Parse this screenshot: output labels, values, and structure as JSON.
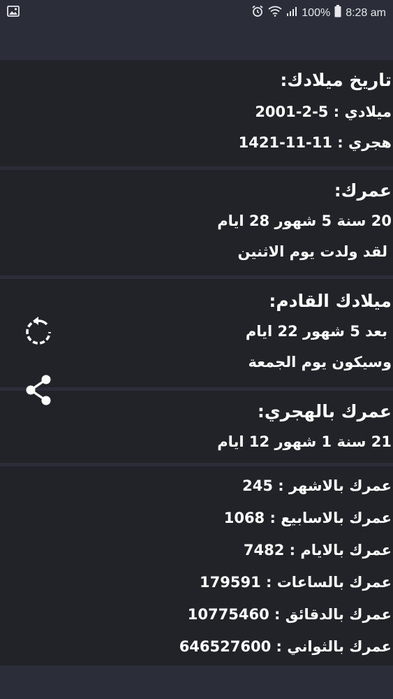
{
  "status_bar": {
    "battery": "100%",
    "time": "8:28 am",
    "left_icon": "image-icon",
    "right_icons": [
      "alarm-icon",
      "wifi-icon",
      "signal-icon",
      "battery-icon"
    ]
  },
  "birth_date": {
    "title": "تاريخ ميلادك:",
    "gregorian_label": "ميلادي :",
    "gregorian_value": "2001-2-5",
    "hijri_label": "هجري :",
    "hijri_value": "1421-11-11"
  },
  "age": {
    "title": "عمرك:",
    "value": "20 سنة 5 شهور 28 ايام",
    "born_day": "لقد ولدت يوم الاثنين"
  },
  "next_birthday": {
    "title": "ميلادك القادم:",
    "remaining": "بعد 5 شهور 22 ايام",
    "day": "وسيكون يوم الجمعة"
  },
  "hijri_age": {
    "title": "عمرك بالهجري:",
    "value": "21 سنة 1 شهور 12 ايام"
  },
  "totals": [
    {
      "label": "عمرك بالاشهر :",
      "value": "245"
    },
    {
      "label": "عمرك بالاسابيع :",
      "value": "1068"
    },
    {
      "label": "عمرك بالايام :",
      "value": "7482"
    },
    {
      "label": "عمرك بالساعات :",
      "value": "179591"
    },
    {
      "label": "عمرك بالدقائق :",
      "value": "10775460"
    },
    {
      "label": "عمرك بالثواني :",
      "value": "646527600"
    }
  ],
  "actions": {
    "refresh_icon": "refresh-icon",
    "share_icon": "share-icon"
  }
}
